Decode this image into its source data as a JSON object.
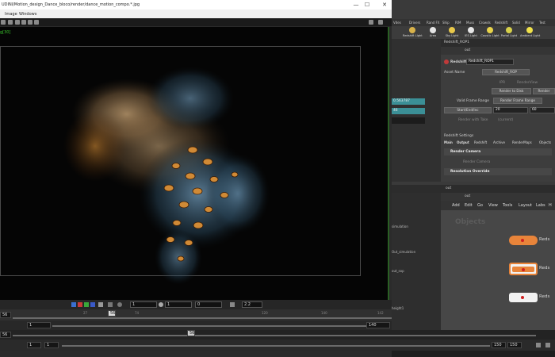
{
  "render_view": {
    "title": "UDINI/Motion_design_Dance_bloco/render/dance_motion_compo.*.jpg",
    "window_buttons": {
      "minimize": "—",
      "maximize": "☐",
      "close": "✕"
    },
    "menu": [
      "Image",
      "Windows"
    ],
    "frame_label": "g[30]",
    "controls": {
      "field_a": "1",
      "field_b": "1",
      "field_c": "0",
      "gamma": "2.2"
    },
    "ruler": {
      "current_frame": "56",
      "marker": "56",
      "ticks": [
        "27",
        "74",
        "120",
        "140",
        "142"
      ]
    },
    "range": {
      "start": "1",
      "end": "140"
    },
    "bottom1": {
      "left_value": "56",
      "marker": "56"
    },
    "bottom2": {
      "start": "1",
      "start2": "1",
      "end1": "150",
      "end2": "150"
    }
  },
  "houdini": {
    "shelf_tabs": [
      "Vdes",
      "Drivers",
      "Rand FX",
      "Ship",
      "RIM",
      "Muss",
      "Crowds",
      "Redshift",
      "Solid",
      "Mirror",
      "Test"
    ],
    "shelf_tools": [
      {
        "label": "Redshift Light",
        "color": "#d8b24a"
      },
      {
        "label": "Area",
        "color": "#e6e6e6"
      },
      {
        "label": "Sky Light",
        "color": "#e8c84a"
      },
      {
        "label": "IES Light",
        "color": "#e6e6e6"
      },
      {
        "label": "Caustic Light",
        "color": "#e8d44a"
      },
      {
        "label": "Portal Light",
        "color": "#d6d04a"
      },
      {
        "label": "Ambient Light",
        "color": "#f0e24a"
      }
    ],
    "param_tab": "Redshift_ROP1",
    "param_path": "out",
    "node_type": "Redshift",
    "node_name": "Redshift_ROP1",
    "asset_name_label": "Asset Name",
    "asset_name_value": "Redshift_ROP",
    "ipr_label": "IPR",
    "render_view_label": "RenderView",
    "render_to_disk": "Render to Disk",
    "render_btn": "Render",
    "valid_frame_range_label": "Valid Frame Range",
    "valid_frame_range_value": "Render Frame Range",
    "start_end_inc_label": "Start/End/Inc",
    "start_value": "20",
    "end_value": "60",
    "render_with_take_label": "Render with Take",
    "render_with_take_value": "(current)",
    "settings_label": "Redshift Settings",
    "tabs": [
      "Main",
      "Output",
      "Redshift",
      "Archive",
      "RenderMaps",
      "Objects"
    ],
    "render_camera_section": "Render Camera",
    "render_camera_label": "Render Camera",
    "resolution_section": "Resolution Override",
    "left_fields": {
      "value1": "0.563787",
      "value2": "46"
    },
    "network": {
      "tab": "out",
      "path": "out",
      "menu": [
        "Add",
        "Edit",
        "Go",
        "View",
        "Tools",
        "Layout",
        "Labs",
        "H"
      ],
      "watermark": "Objects",
      "left_labels": [
        "simulation",
        "Out_simulation",
        "out_sop",
        "height1"
      ],
      "nodes": [
        "Reds",
        "Reds",
        "Reds"
      ]
    }
  }
}
